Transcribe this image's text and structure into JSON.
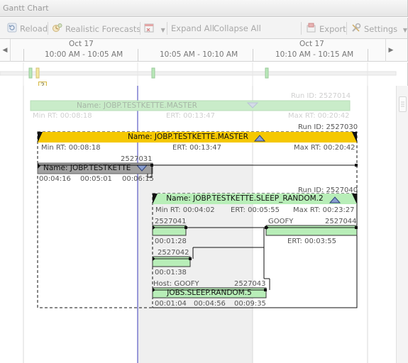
{
  "window": {
    "title": "Gantt Chart"
  },
  "toolbar": {
    "reload": "Reload",
    "realistic_forecasts": "Realistic Forecasts",
    "expand_all": "Expand All",
    "collapse_all": "Collapse All",
    "export": "Export",
    "settings": "Settings"
  },
  "timeline": {
    "dates": [
      "Oct 17",
      "Oct 17"
    ],
    "ranges": [
      "10:00 AM - 10:05 AM",
      "10:05 AM - 10:10 AM",
      "10:10 AM - 10:15 AM"
    ]
  },
  "overview": {
    "badge": "2"
  },
  "ghost": {
    "run_id": "Run ID: 2527014",
    "name": "Name: JOBP.TESTKETTE.MASTER",
    "min_rt": "Min RT: 00:08:18",
    "ert": "ERT: 00:13:47",
    "max_rt": "Max RT: 00:20:42"
  },
  "master": {
    "run_id": "Run ID: 2527030",
    "name": "Name: JOBP.TESTKETTE.MASTER",
    "min_rt": "Min RT: 00:08:18",
    "ert": "ERT: 00:13:47",
    "max_rt": "Max RT: 00:20:42"
  },
  "testkette": {
    "run_id": "2527031",
    "name": "Name: JOBP.TESTKETTE",
    "t1": "00:04:16",
    "t2": "00:05:01",
    "t3": "00:06:15"
  },
  "sleep": {
    "run_id": "Run ID: 2527040",
    "name": "Name: JOBP.TESTKETTE.SLEEP_RANDOM.2",
    "min_rt": "Min RT: 00:04:02",
    "ert": "ERT: 00:05:55",
    "max_rt": "Max RT: 00:23:27"
  },
  "tasks": {
    "t041": {
      "id": "2527041",
      "time": "00:01:28"
    },
    "t044": {
      "host": "GOOFY",
      "id": "2527044",
      "ert": "ERT: 00:03:55"
    },
    "t042": {
      "id": "2527042",
      "time": "00:01:38"
    },
    "t043": {
      "host": "Host: GOOFY",
      "id": "2527043",
      "name": "JOBS.SLEEP.RANDOM.5",
      "t1": "00:01:04",
      "t2": "00:04:56",
      "t3": "00:09:35"
    }
  },
  "colors": {
    "gold": "#f5c800",
    "green": "#b8eeb8",
    "gray_bar": "#a0a0a0",
    "marker": "#00008b"
  }
}
